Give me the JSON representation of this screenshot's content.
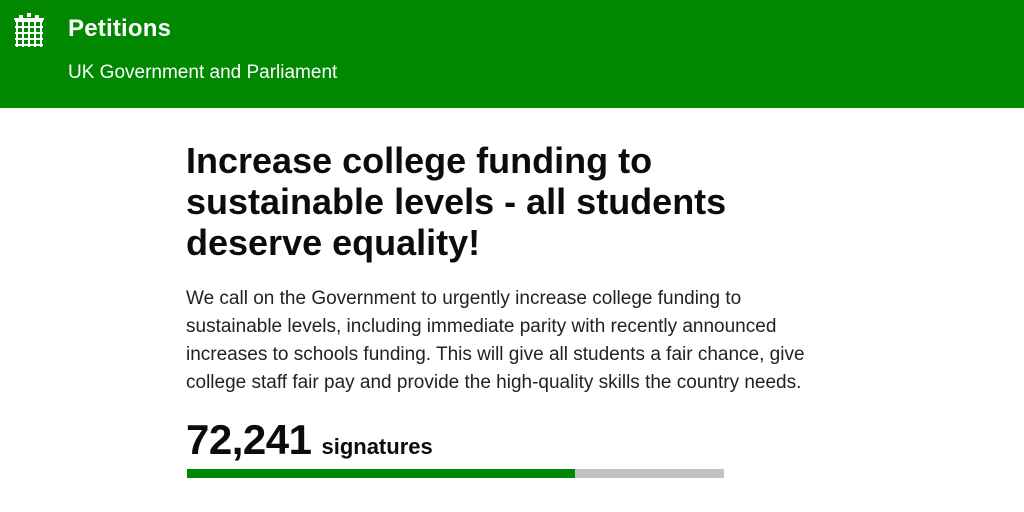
{
  "header": {
    "logo_icon": "portcullis-icon",
    "title": "Petitions",
    "subtitle": "UK Government and Parliament",
    "color": "#008800"
  },
  "petition": {
    "title": "Increase college funding to sustainable levels - all students deserve equality!",
    "description": "We call on the Government to urgently increase college funding to sustainable levels, including immediate parity with recently announced increases to schools funding. This will give all students a fair chance, give college staff fair pay and provide the high-quality skills the country needs.",
    "signature_count": "72,241",
    "signature_label": "signatures",
    "progress_fraction": 0.722,
    "progress_color": "#008800",
    "track_color": "#bfc1c3"
  }
}
